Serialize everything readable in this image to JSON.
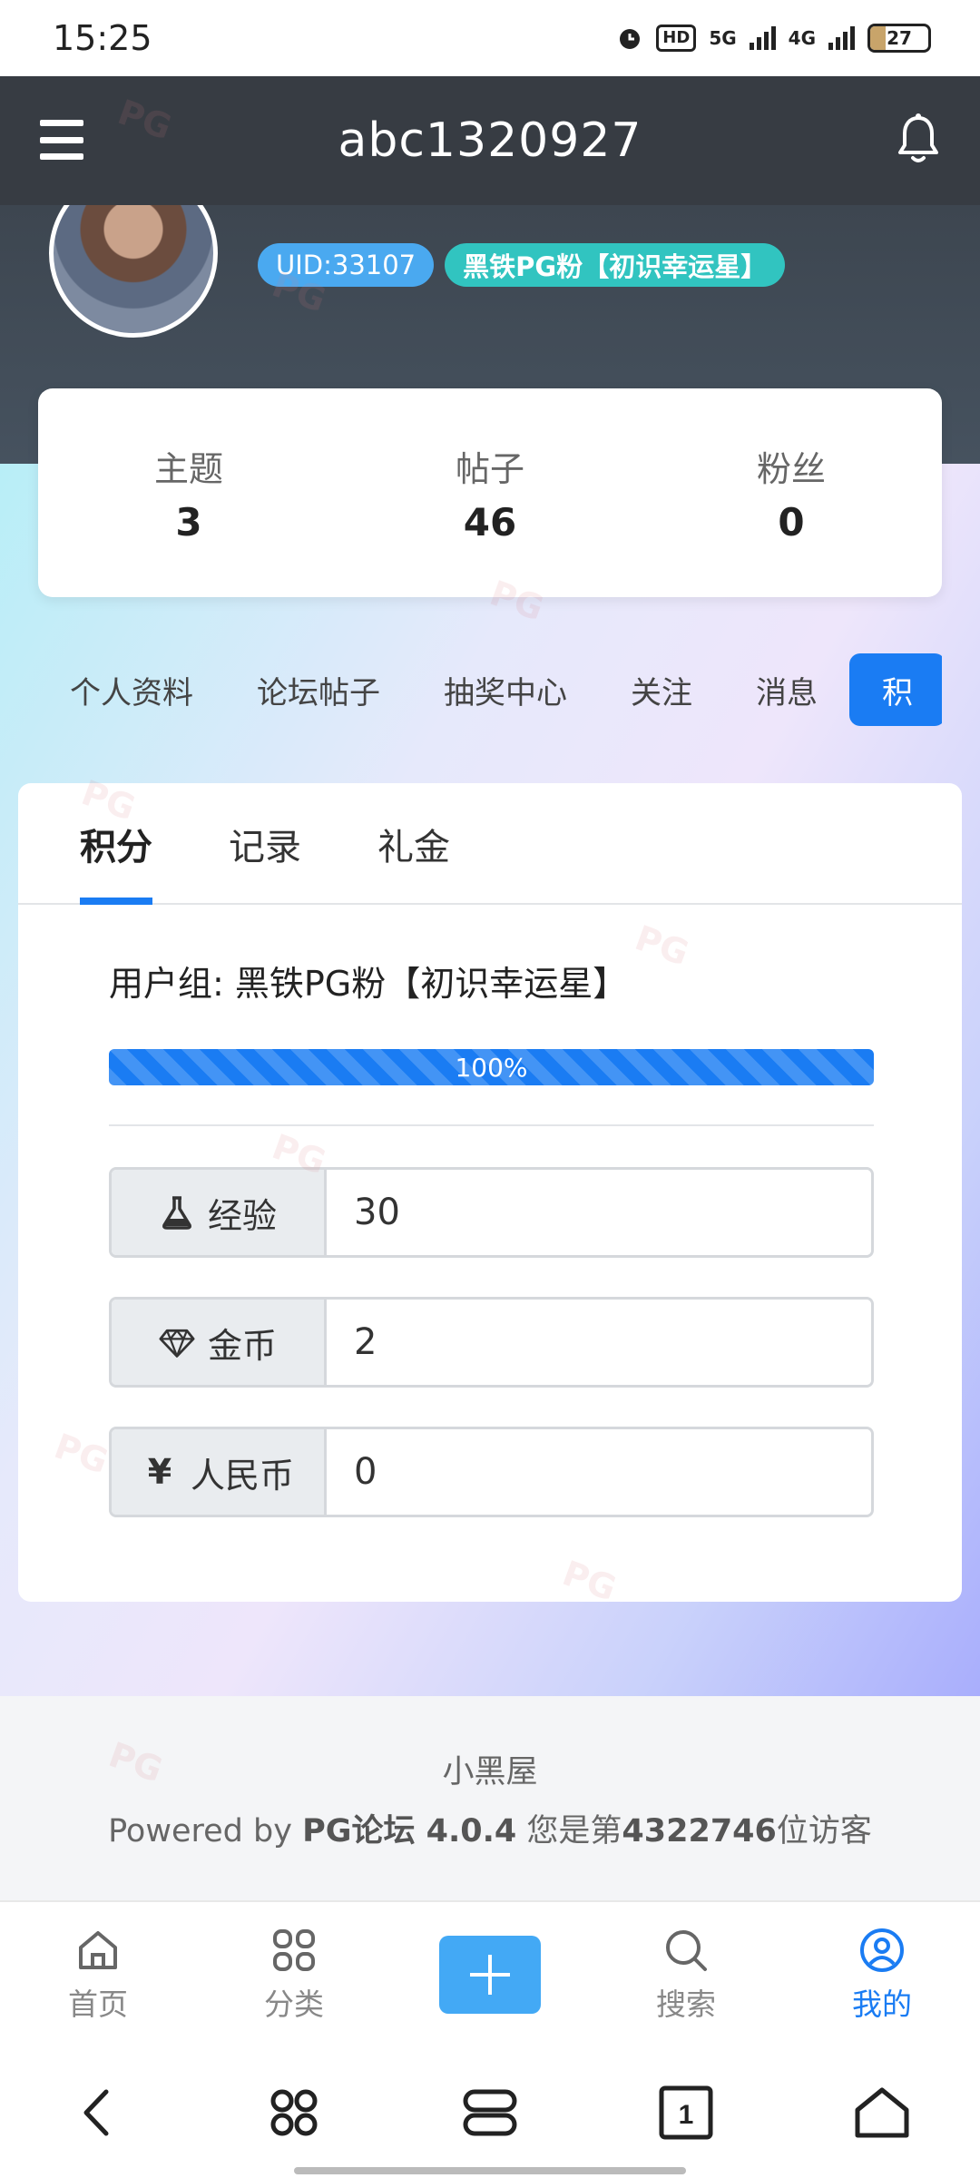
{
  "status_bar": {
    "time": "15:25",
    "hd_label": "HD",
    "net1": "5G",
    "net2": "4G",
    "battery": "27",
    "battery_level": 0.27
  },
  "header": {
    "title": "abc1320927"
  },
  "profile": {
    "uid": "UID:33107",
    "group_badge": "黑铁PG粉【初识幸运星】"
  },
  "stats": [
    {
      "label": "主题",
      "value": "3"
    },
    {
      "label": "帖子",
      "value": "46"
    },
    {
      "label": "粉丝",
      "value": "0"
    }
  ],
  "profile_tabs": [
    "个人资料",
    "论坛帖子",
    "抽奖中心",
    "关注",
    "消息",
    "积"
  ],
  "sub_tabs": [
    "积分",
    "记录",
    "礼金"
  ],
  "credits": {
    "group_line": "用户组: 黑铁PG粉【初识幸运星】",
    "progress_label": "100%",
    "progress": 1.0,
    "fields": [
      {
        "label": "经验",
        "icon": "flask-icon",
        "value": "30"
      },
      {
        "label": "金币",
        "icon": "diamond-icon",
        "value": "2"
      },
      {
        "label": "人民币",
        "icon": "yen-icon",
        "value": "0"
      }
    ]
  },
  "footer": {
    "site_name": "小黑屋",
    "powered_prefix": "Powered by ",
    "powered_brand": "PG论坛 4.0.4",
    "visitor_prefix": " 您是第",
    "visitor_count": "4322746",
    "visitor_suffix": "位访客"
  },
  "bottom_nav": [
    {
      "label": "首页",
      "icon": "home-icon"
    },
    {
      "label": "分类",
      "icon": "grid-icon"
    },
    {
      "label": "",
      "icon": "plus-icon"
    },
    {
      "label": "搜索",
      "icon": "search-icon"
    },
    {
      "label": "我的",
      "icon": "user-icon"
    }
  ],
  "accent_color": "#1a7cf3"
}
